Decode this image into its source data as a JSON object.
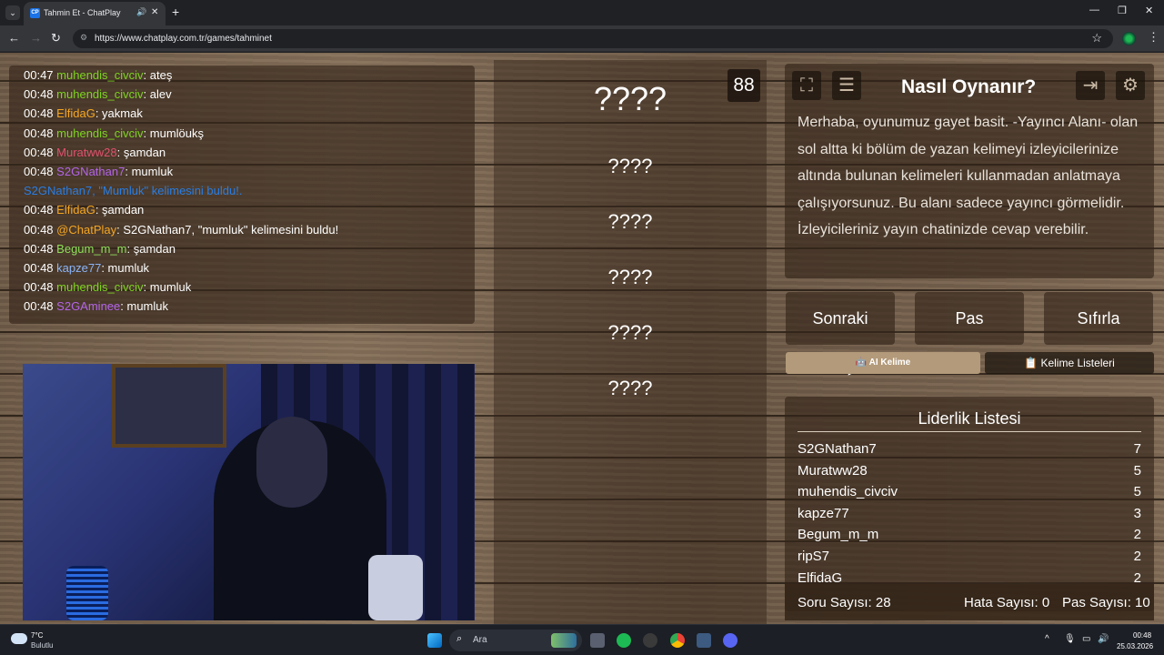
{
  "browser": {
    "tab_title": "Tahmin Et - ChatPlay",
    "tab_favicon": "CP",
    "url": "https://www.chatplay.com.tr/games/tahminet"
  },
  "chat": {
    "lines": [
      {
        "time": "00:47",
        "user": "muhendis_civciv",
        "color": "#7ed321",
        "msg": ": ateş"
      },
      {
        "time": "00:48",
        "user": "muhendis_civciv",
        "color": "#7ed321",
        "msg": ": alev"
      },
      {
        "time": "00:48",
        "user": "ElfidaG",
        "color": "#f5a623",
        "msg": ": yakmak"
      },
      {
        "time": "00:48",
        "user": "muhendis_civciv",
        "color": "#7ed321",
        "msg": ": mumlöukş"
      },
      {
        "time": "00:48",
        "user": "Muratww28",
        "color": "#e0506e",
        "msg": ": şamdan"
      },
      {
        "time": "00:48",
        "user": "S2GNathan7",
        "color": "#b365e8",
        "msg": ": mumluk"
      },
      {
        "system": "S2GNathan7, \"Mumluk\" kelimesini buldu!.",
        "color": "#2a7de1"
      },
      {
        "time": "00:48",
        "user": "ElfidaG",
        "color": "#f5a623",
        "msg": ": şamdan"
      },
      {
        "time": "00:48",
        "user": "@ChatPlay",
        "color": "#f5a623",
        "msg": ": S2GNathan7, \"mumluk\" kelimesini buldu!"
      },
      {
        "time": "00:48",
        "user": "Begum_m_m",
        "color": "#8ee05a",
        "msg": ": şamdan"
      },
      {
        "time": "00:48",
        "user": "kapze77",
        "color": "#8ab4f8",
        "msg": ": mumluk"
      },
      {
        "time": "00:48",
        "user": "muhendis_civciv",
        "color": "#7ed321",
        "msg": ": mumluk"
      },
      {
        "time": "00:48",
        "user": "S2GAminee",
        "color": "#b365e8",
        "msg": ": mumluk"
      }
    ]
  },
  "game": {
    "counter": "88",
    "main_word": "????",
    "hidden_words": [
      "????",
      "????",
      "????",
      "????",
      "????"
    ]
  },
  "howto": {
    "title": "Nasıl Oynanır?",
    "text": "Merhaba, oyunumuz gayet basit. -Yayıncı Alanı- olan sol altta ki bölüm de yazan kelimeyi izleyicilerinize altında bulunan kelimeleri kullanmadan anlatmaya çalışıyorsunuz. Bu alanı sadece yayıncı görmelidir. İzleyicileriniz yayın chatinizde cevap verebilir.",
    "icons": [
      "fullscreen-icon",
      "document-icon",
      "exit-icon",
      "gear-icon"
    ]
  },
  "controls": {
    "next": "Sonraki",
    "pass": "Pas",
    "reset": "Sıfırla",
    "ai_word": "AI Kelime",
    "word_lists": "Kelime Listeleri"
  },
  "leaderboard": {
    "title": "Liderlik Listesi",
    "rows": [
      {
        "name": "S2GNathan7",
        "score": "7"
      },
      {
        "name": "Muratww28",
        "score": "5"
      },
      {
        "name": "muhendis_civciv",
        "score": "5"
      },
      {
        "name": "kapze77",
        "score": "3"
      },
      {
        "name": "Begum_m_m",
        "score": "2"
      },
      {
        "name": "ripS7",
        "score": "2"
      },
      {
        "name": "ElfidaG",
        "score": "2"
      }
    ]
  },
  "stats": {
    "questions": "Soru Sayısı: 28",
    "errors": "Hata Sayısı: 0",
    "passes": "Pas Sayısı: 10"
  },
  "taskbar": {
    "temp": "7°C",
    "weather": "Bulutlu",
    "search_placeholder": "Ara",
    "time": "00:48",
    "date": "25.03.2026"
  }
}
